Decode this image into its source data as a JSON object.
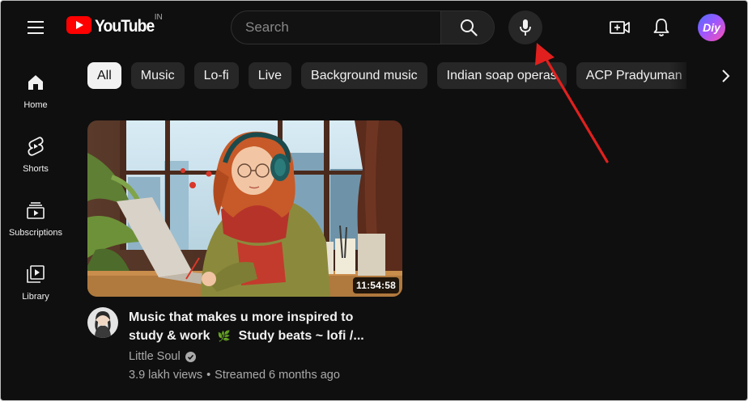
{
  "header": {
    "logo_text": "YouTube",
    "country_code": "IN",
    "search_placeholder": "Search",
    "icons": [
      "menu-icon",
      "search-icon",
      "mic-icon",
      "create-video-icon",
      "notifications-bell-icon"
    ],
    "avatar_initials": "Diy"
  },
  "chips": {
    "items": [
      {
        "label": "All",
        "active": true
      },
      {
        "label": "Music"
      },
      {
        "label": "Lo-fi"
      },
      {
        "label": "Live"
      },
      {
        "label": "Background music"
      },
      {
        "label": "Indian soap operas"
      },
      {
        "label": "ACP Pradyuman"
      }
    ]
  },
  "sidebar": {
    "items": [
      {
        "label": "Home",
        "icon": "home-icon"
      },
      {
        "label": "Shorts",
        "icon": "shorts-icon"
      },
      {
        "label": "Subscriptions",
        "icon": "subscriptions-icon"
      },
      {
        "label": "Library",
        "icon": "library-icon"
      }
    ]
  },
  "video": {
    "duration": "11:54:58",
    "title_line1": "Music that makes u more inspired to",
    "title_line2_a": "study & work",
    "title_leaf": "🌿",
    "title_line2_b": "Study beats ~ lofi /...",
    "channel": "Little Soul",
    "views": "3.9 lakh views",
    "separator": "•",
    "age": "Streamed 6 months ago"
  },
  "colors": {
    "background": "#0f0f0f",
    "brand_red": "#ff0000",
    "chip_bg": "#272727",
    "chip_active_bg": "#f1f1f1",
    "annotation_arrow": "#e0201e"
  }
}
